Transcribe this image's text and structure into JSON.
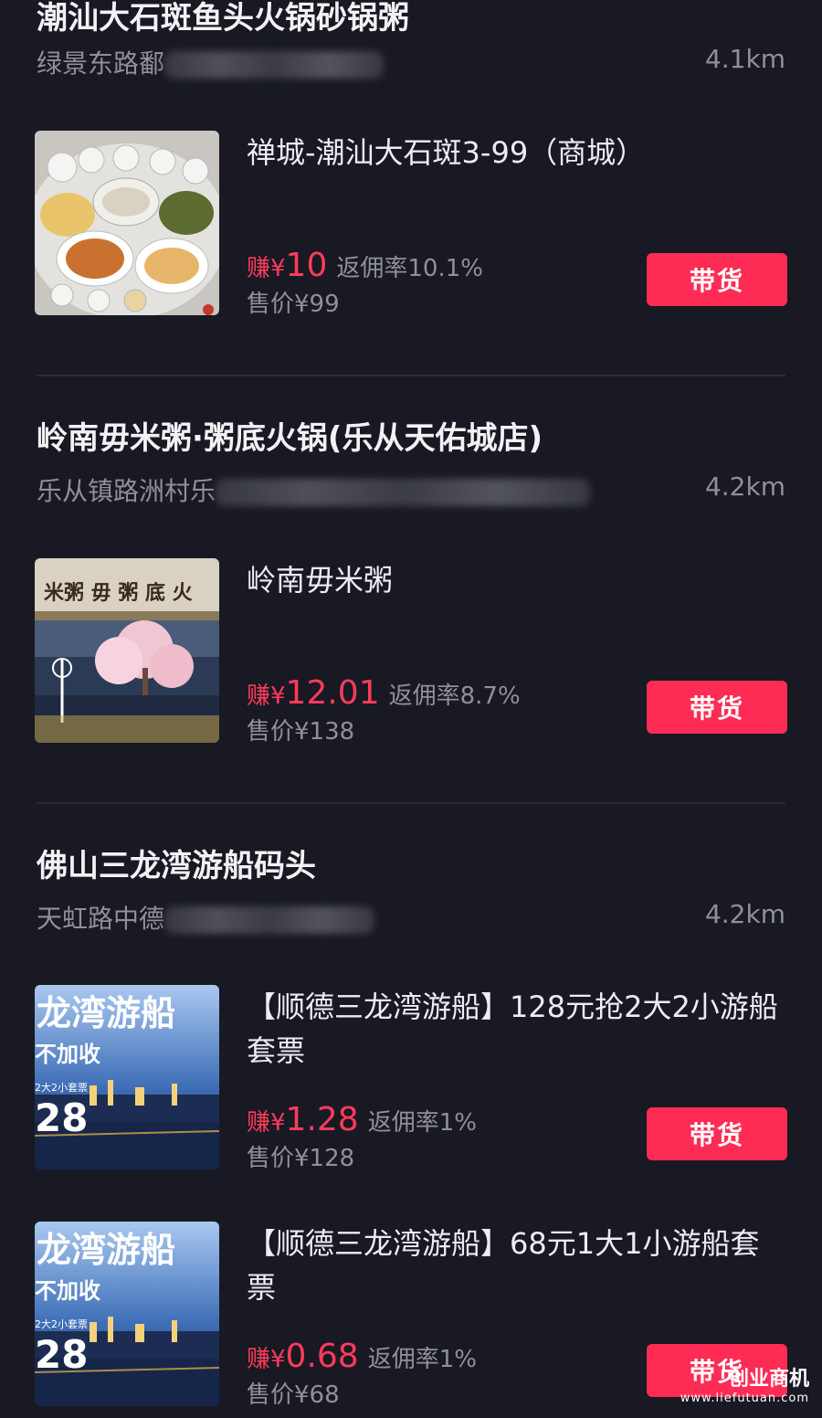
{
  "stores": [
    {
      "title": "潮汕大石斑鱼头火锅砂锅粥",
      "address": "绿景东路鄱",
      "distance": "4.1km",
      "products": [
        {
          "name": "禅城-潮汕大石斑3-99（商城）",
          "earn_label": "赚¥",
          "earn": "10",
          "rate": "返佣率10.1%",
          "price": "售价¥99",
          "button": "带货"
        }
      ]
    },
    {
      "title": "岭南毋米粥·粥底火锅(乐从天佑城店)",
      "address": "乐从镇路洲村乐",
      "distance": "4.2km",
      "products": [
        {
          "name": "岭南毋米粥",
          "earn_label": "赚¥",
          "earn": "12.01",
          "rate": "返佣率8.7%",
          "price": "售价¥138",
          "button": "带货"
        }
      ]
    },
    {
      "title": "佛山三龙湾游船码头",
      "address": "天虹路中德",
      "distance": "4.2km",
      "products": [
        {
          "name": "【顺德三龙湾游船】128元抢2大2小游船套票",
          "earn_label": "赚¥",
          "earn": "1.28",
          "rate": "返佣率1%",
          "price": "售价¥128",
          "button": "带货"
        },
        {
          "name": "【顺德三龙湾游船】68元1大1小游船套票",
          "earn_label": "赚¥",
          "earn": "0.68",
          "rate": "返佣率1%",
          "price": "售价¥68",
          "button": "带货"
        }
      ]
    }
  ],
  "thumb_text": {
    "boat_title": "龙湾游船",
    "boat_sub": "不加收",
    "boat_small": "2大2小套票",
    "boat_num": "28",
    "porridge_sign": "米粥 毋 粥 底 火"
  },
  "watermark": {
    "title": "创业商机",
    "url": "www.liefutuan.com"
  }
}
